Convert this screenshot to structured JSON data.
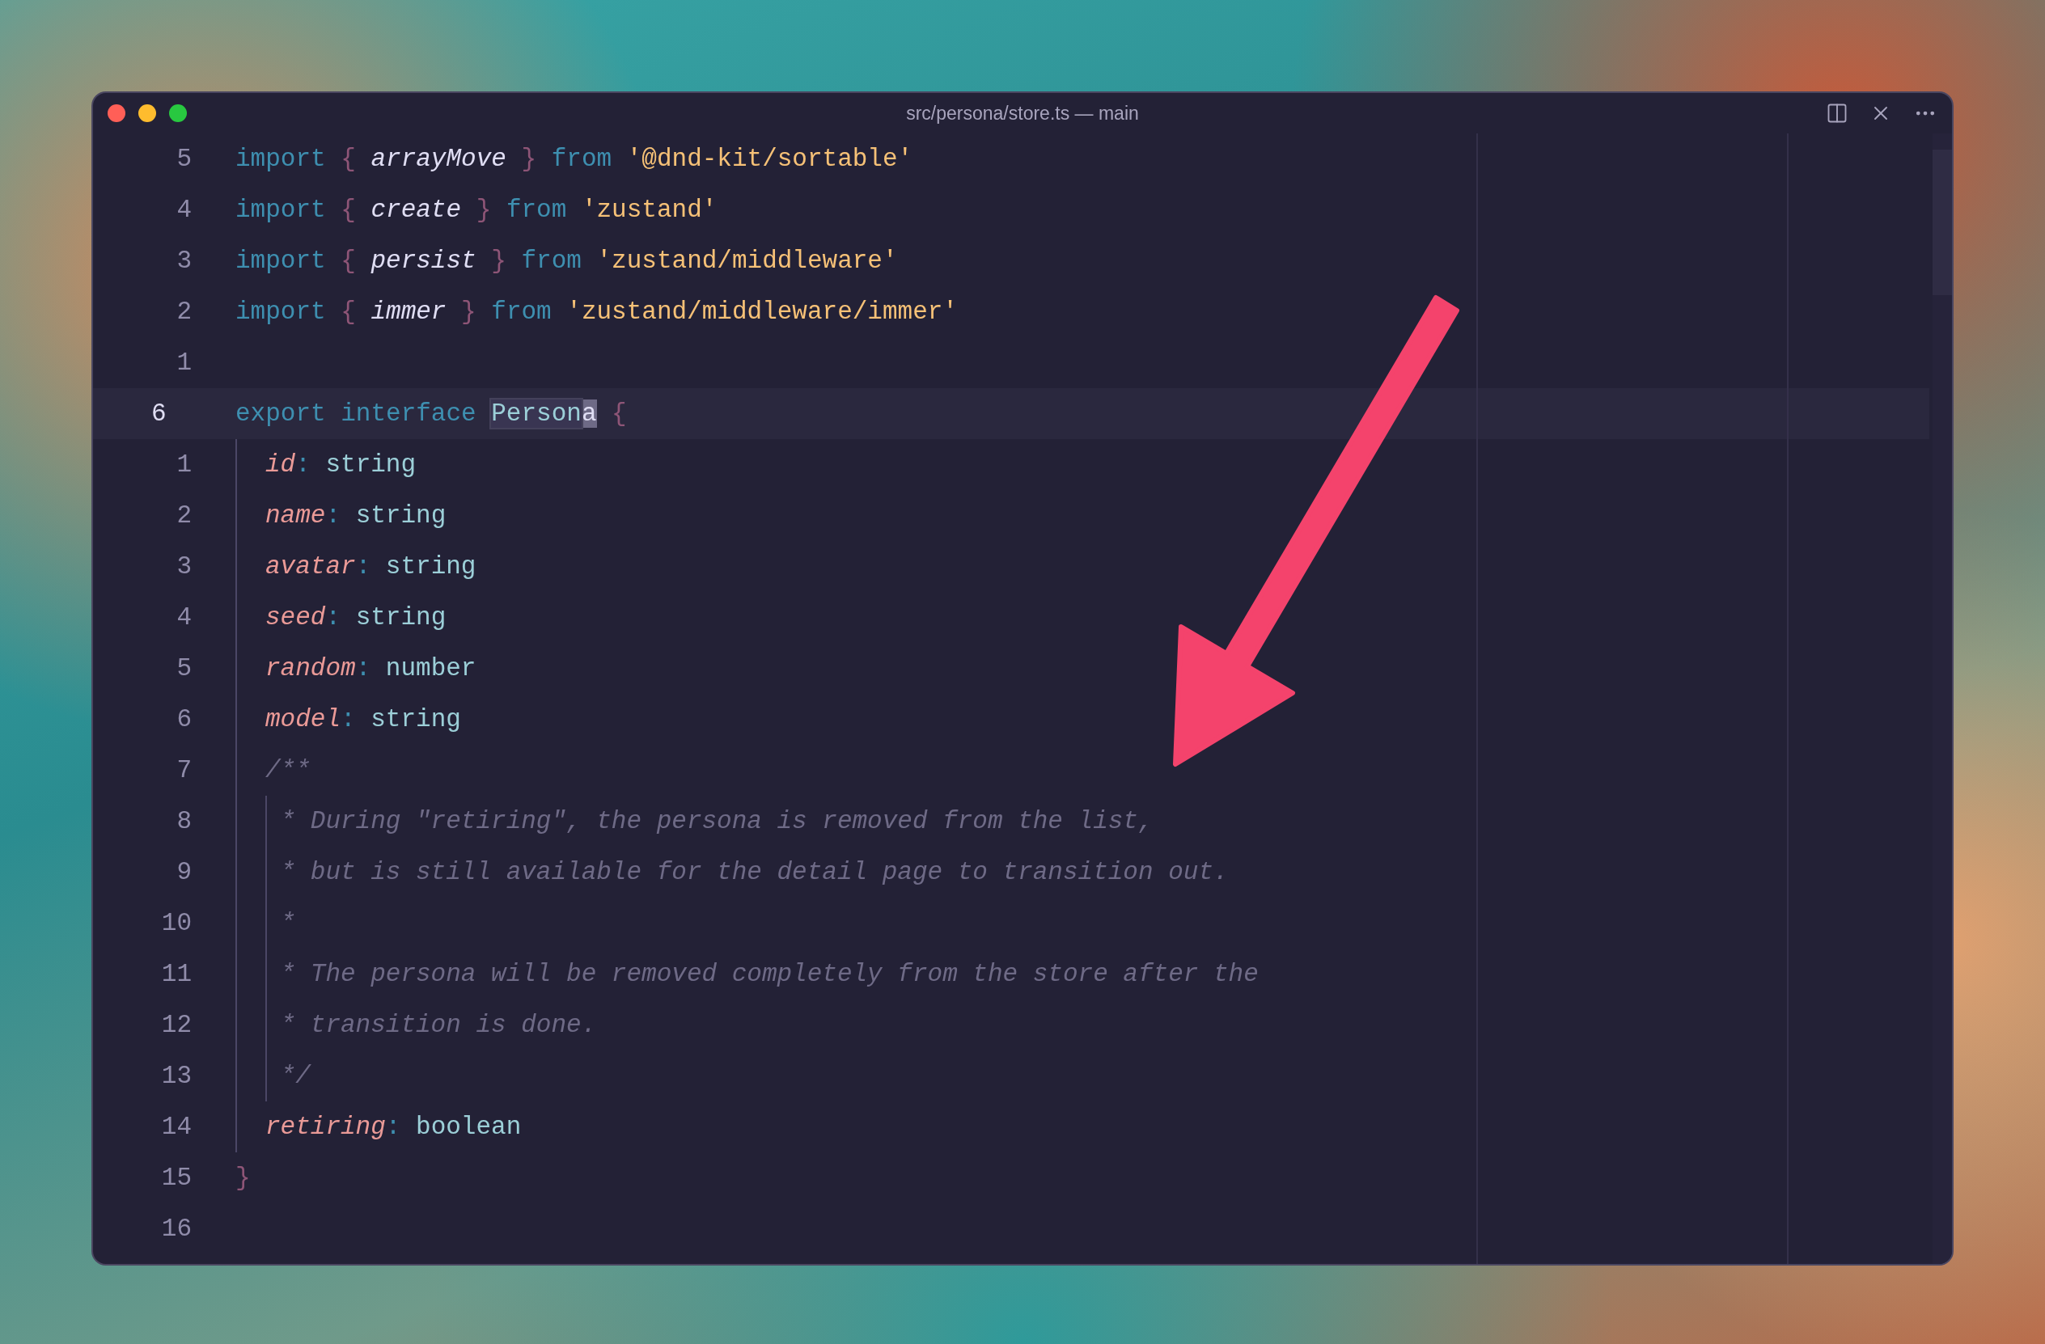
{
  "window": {
    "title": "src/persona/store.ts — main"
  },
  "editor": {
    "lines": [
      {
        "number": "5",
        "current": false,
        "tokens": [
          {
            "kind": "keyword",
            "text": "import "
          },
          {
            "kind": "brace",
            "text": "{ "
          },
          {
            "kind": "ident",
            "text": "arrayMove"
          },
          {
            "kind": "brace",
            "text": " } "
          },
          {
            "kind": "keyword",
            "text": "from "
          },
          {
            "kind": "string",
            "text": "'@dnd-kit/sortable'"
          }
        ]
      },
      {
        "number": "4",
        "current": false,
        "tokens": [
          {
            "kind": "keyword",
            "text": "import "
          },
          {
            "kind": "brace",
            "text": "{ "
          },
          {
            "kind": "ident",
            "text": "create"
          },
          {
            "kind": "brace",
            "text": " } "
          },
          {
            "kind": "keyword",
            "text": "from "
          },
          {
            "kind": "string",
            "text": "'zustand'"
          }
        ]
      },
      {
        "number": "3",
        "current": false,
        "tokens": [
          {
            "kind": "keyword",
            "text": "import "
          },
          {
            "kind": "brace",
            "text": "{ "
          },
          {
            "kind": "ident",
            "text": "persist"
          },
          {
            "kind": "brace",
            "text": " } "
          },
          {
            "kind": "keyword",
            "text": "from "
          },
          {
            "kind": "string",
            "text": "'zustand/middleware'"
          }
        ]
      },
      {
        "number": "2",
        "current": false,
        "tokens": [
          {
            "kind": "keyword",
            "text": "import "
          },
          {
            "kind": "brace",
            "text": "{ "
          },
          {
            "kind": "ident",
            "text": "immer"
          },
          {
            "kind": "brace",
            "text": " } "
          },
          {
            "kind": "keyword",
            "text": "from "
          },
          {
            "kind": "string",
            "text": "'zustand/middleware/immer'"
          }
        ]
      },
      {
        "number": "1",
        "current": false
      },
      {
        "number": "6",
        "current": true,
        "tokens": [
          {
            "kind": "keyword",
            "text": "export interface "
          },
          {
            "kind": "match",
            "text": "Person"
          },
          {
            "kind": "cursor",
            "text": "a"
          },
          {
            "kind": "brace",
            "text": " {"
          }
        ],
        "children": [
          {
            "number": "1",
            "current": false,
            "tokens": [
              {
                "kind": "prop",
                "text": "id"
              },
              {
                "kind": "colon",
                "text": ": "
              },
              {
                "kind": "type",
                "text": "string"
              }
            ]
          },
          {
            "number": "2",
            "current": false,
            "tokens": [
              {
                "kind": "prop",
                "text": "name"
              },
              {
                "kind": "colon",
                "text": ": "
              },
              {
                "kind": "type",
                "text": "string"
              }
            ]
          },
          {
            "number": "3",
            "current": false,
            "tokens": [
              {
                "kind": "prop",
                "text": "avatar"
              },
              {
                "kind": "colon",
                "text": ": "
              },
              {
                "kind": "type",
                "text": "string"
              }
            ]
          },
          {
            "number": "4",
            "current": false,
            "tokens": [
              {
                "kind": "prop",
                "text": "seed"
              },
              {
                "kind": "colon",
                "text": ": "
              },
              {
                "kind": "type",
                "text": "string"
              }
            ]
          },
          {
            "number": "5",
            "current": false,
            "tokens": [
              {
                "kind": "prop",
                "text": "random"
              },
              {
                "kind": "colon",
                "text": ": "
              },
              {
                "kind": "type",
                "text": "number"
              }
            ]
          },
          {
            "number": "6",
            "current": false,
            "tokens": [
              {
                "kind": "prop",
                "text": "model"
              },
              {
                "kind": "colon",
                "text": ": "
              },
              {
                "kind": "type",
                "text": "string"
              }
            ]
          },
          {
            "number": "7",
            "current": false,
            "tokens": [
              {
                "kind": "comment",
                "text": "/**"
              }
            ],
            "children": [
              {
                "number": "8",
                "current": false,
                "tokens": [
                  {
                    "kind": "comment",
                    "text": "* During \"retiring\", the persona is removed from the list,"
                  }
                ]
              },
              {
                "number": "9",
                "current": false,
                "tokens": [
                  {
                    "kind": "comment",
                    "text": "* but is still available for the detail page to transition out."
                  }
                ]
              },
              {
                "number": "10",
                "current": false,
                "tokens": [
                  {
                    "kind": "comment",
                    "text": "*"
                  }
                ]
              },
              {
                "number": "11",
                "current": false,
                "tokens": [
                  {
                    "kind": "comment",
                    "text": "* The persona will be removed completely from the store after the"
                  }
                ]
              },
              {
                "number": "12",
                "current": false,
                "tokens": [
                  {
                    "kind": "comment",
                    "text": "* transition is done."
                  }
                ]
              },
              {
                "number": "13",
                "current": false,
                "tokens": [
                  {
                    "kind": "comment",
                    "text": "*/"
                  }
                ]
              }
            ]
          },
          {
            "number": "14",
            "current": false,
            "tokens": [
              {
                "kind": "prop",
                "text": "retiring"
              },
              {
                "kind": "colon",
                "text": ": "
              },
              {
                "kind": "type",
                "text": "boolean"
              }
            ]
          }
        ]
      },
      {
        "number": "15",
        "current": false,
        "tokens": [
          {
            "kind": "brace",
            "text": "}"
          }
        ]
      },
      {
        "number": "16",
        "current": false
      }
    ]
  }
}
